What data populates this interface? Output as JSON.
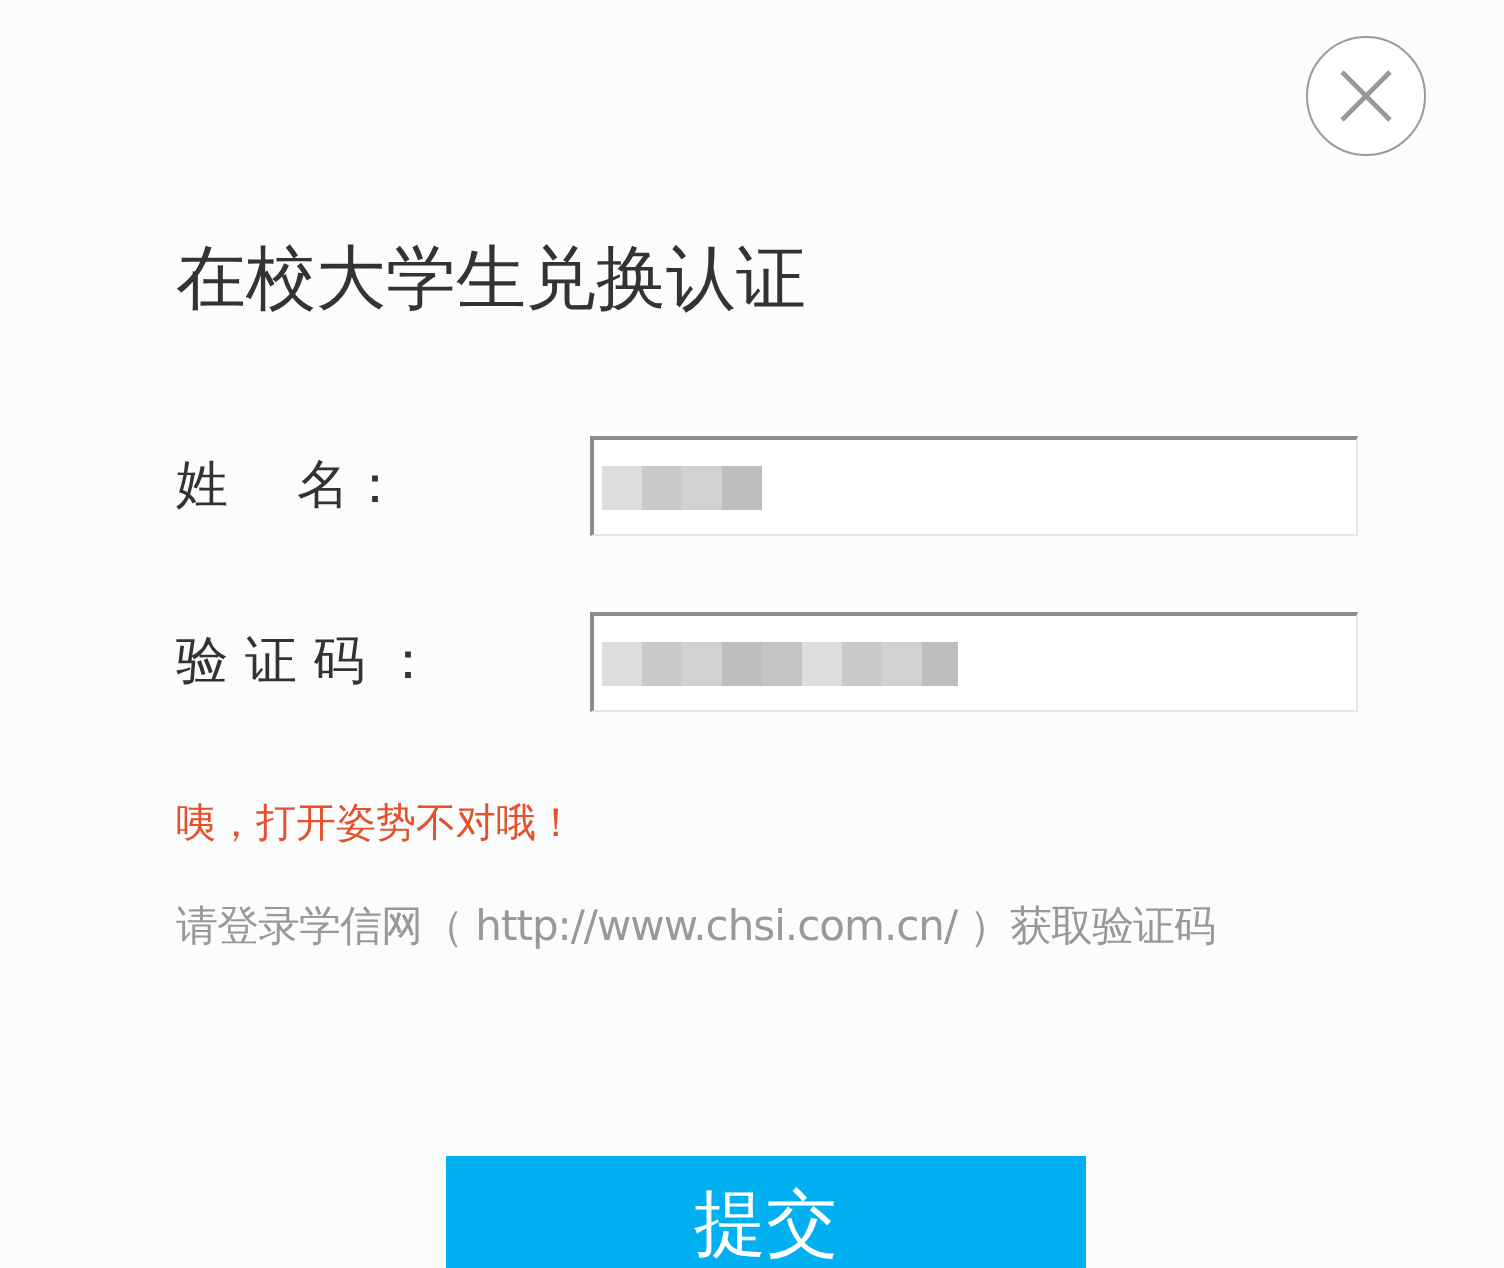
{
  "dialog": {
    "title": "在校大学生兑换认证",
    "fields": [
      {
        "label": "姓　 名：",
        "redacted": true
      },
      {
        "label": "验 证 码 ：",
        "redacted": true
      }
    ],
    "error": "咦，打开姿势不对哦！",
    "hint": "请登录学信网（ http://www.chsi.com.cn/ ）获取验证码",
    "submit": "提交"
  }
}
